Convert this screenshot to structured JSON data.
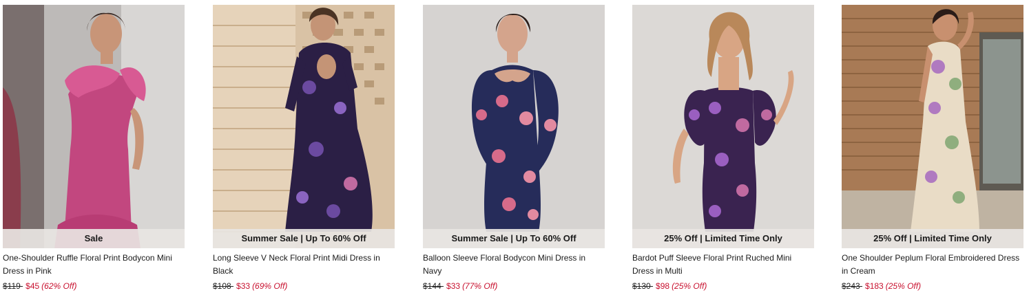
{
  "products": [
    {
      "badge": "Sale",
      "name": "One-Shoulder Ruffle Floral Print Bodycon Mini Dress in Pink",
      "was_price": "$119 ",
      "now_price": "$45",
      "discount": "(62% Off)",
      "image": "woman-in-pink-one-shoulder-ruffle-dress",
      "dress_color": "#c2477f"
    },
    {
      "badge": "Summer Sale | Up To 60% Off",
      "name": "Long Sleeve V Neck Floral Print Midi Dress in Black",
      "was_price": "$108 ",
      "now_price": "$33",
      "discount": "(69% Off)",
      "image": "woman-in-black-floral-midi-dress-brick-wall",
      "dress_color": "#2b1f45"
    },
    {
      "badge": "Summer Sale | Up To 60% Off",
      "name": "Balloon Sleeve Floral Bodycon Mini Dress in Navy",
      "was_price": "$144 ",
      "now_price": "$33",
      "discount": "(77% Off)",
      "image": "woman-in-navy-balloon-sleeve-floral-dress",
      "dress_color": "#262c5a"
    },
    {
      "badge": "25% Off | Limited Time Only",
      "name": "Bardot Puff Sleeve Floral Print Ruched Mini Dress in Multi",
      "was_price": "$130 ",
      "now_price": "$98",
      "discount": "(25% Off)",
      "image": "woman-in-multi-bardot-puff-sleeve-dress",
      "dress_color": "#3a2350"
    },
    {
      "badge": "25% Off | Limited Time Only",
      "name": "One Shoulder Peplum Floral Embroidered Dress in Cream",
      "was_price": "$243 ",
      "now_price": "$183",
      "discount": "(25% Off)",
      "image": "woman-in-cream-embroidered-peplum-dress",
      "dress_color": "#e9dcc6"
    }
  ]
}
